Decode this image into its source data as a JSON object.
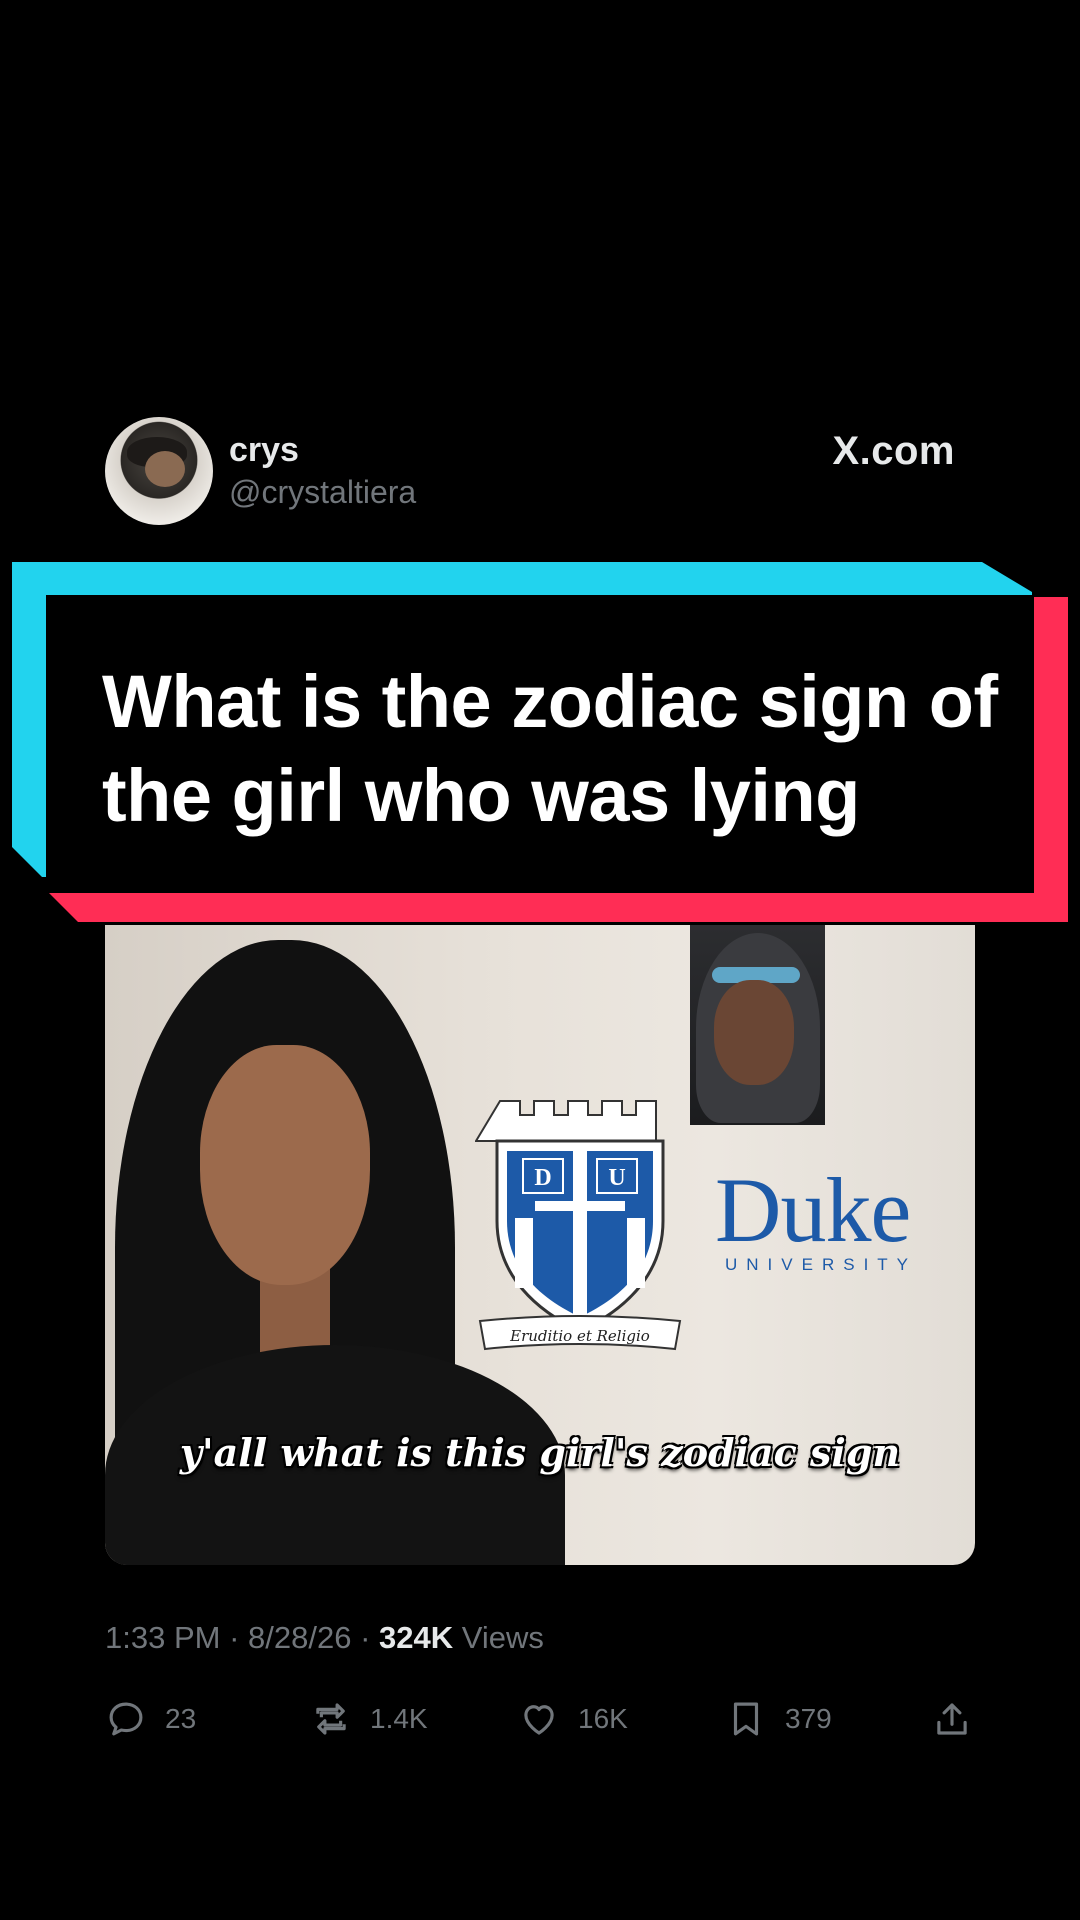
{
  "tweet": {
    "display_name": "crys",
    "handle": "@crystaltiera",
    "site": "X.com"
  },
  "banner": {
    "text": "What is the zodiac sign of the girl who was lying"
  },
  "media": {
    "logo_word": "Duke",
    "logo_sub": "UNIVERSITY",
    "crest_motto": "Eruditio et Religio",
    "caption": "y'all what is this girl's zodiac sign"
  },
  "meta": {
    "time": "1:33 PM",
    "date": "8/28/26",
    "views_count": "324K",
    "views_label": "Views"
  },
  "actions": {
    "replies": "23",
    "reposts": "1.4K",
    "likes": "16K",
    "bookmarks": "379"
  },
  "colors": {
    "banner_cyan": "#22d3ee",
    "banner_red": "#ff2d55",
    "muted_text": "#71767b",
    "duke_blue": "#1d5aa8"
  },
  "icons": [
    "reply-icon",
    "repost-icon",
    "like-icon",
    "bookmark-icon",
    "share-icon",
    "x-logo"
  ]
}
